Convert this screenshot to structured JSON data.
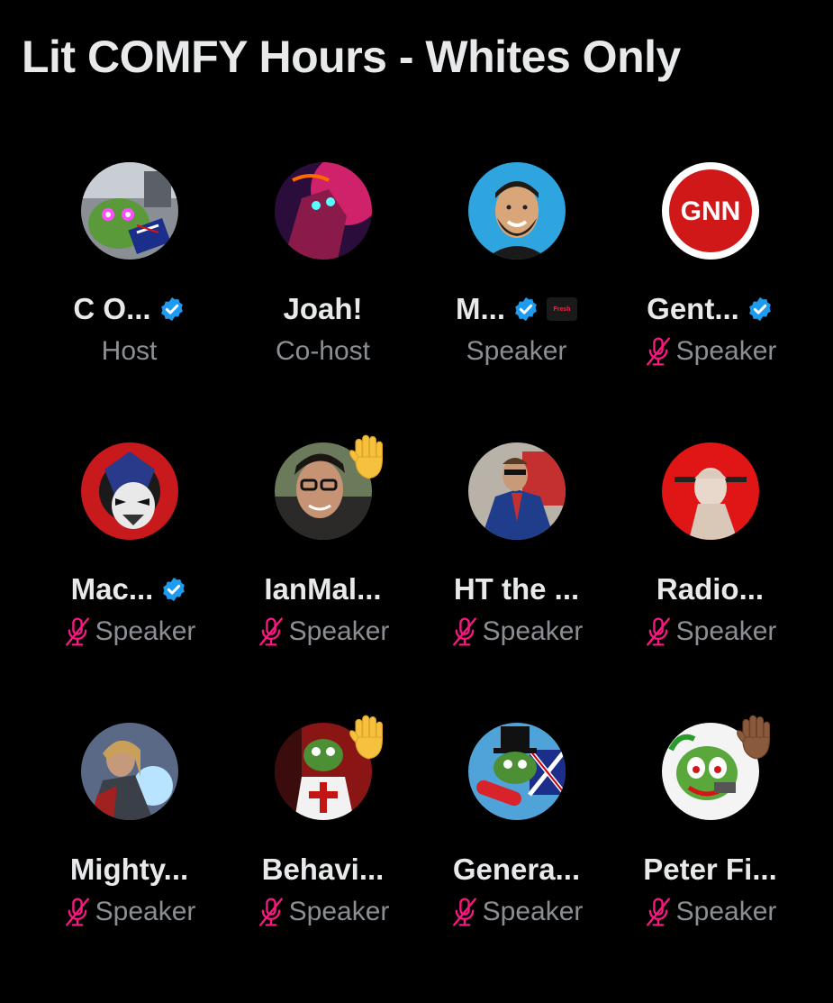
{
  "space": {
    "title": "Lit COMFY Hours - Whites Only"
  },
  "colors": {
    "background": "#000000",
    "name_text": "#e7e9ea",
    "role_text": "#8b8f94",
    "verified_blue": "#1d9bf0",
    "muted_mic": "#f91880"
  },
  "participants": [
    {
      "name": "C O...",
      "role": "Host",
      "verified": true,
      "muted": false,
      "hand_raised": false,
      "avatar_icon": "pepe-flag-avatar"
    },
    {
      "name": "Joah!",
      "role": "Co-host",
      "verified": false,
      "muted": false,
      "hand_raised": false,
      "avatar_icon": "neon-eyes-avatar"
    },
    {
      "name": "M...",
      "role": "Speaker",
      "verified": true,
      "muted": false,
      "hand_raised": false,
      "avatar_icon": "cartoon-man-avatar",
      "affiliate_badge": "Fresh"
    },
    {
      "name": "Gent...",
      "role": "Speaker",
      "verified": true,
      "muted": true,
      "hand_raised": false,
      "avatar_icon": "gnn-logo-avatar",
      "avatar_text": "GNN"
    },
    {
      "name": "Mac...",
      "role": "Speaker",
      "verified": true,
      "muted": true,
      "hand_raised": false,
      "avatar_icon": "mask-avatar"
    },
    {
      "name": "IanMal...",
      "role": "Speaker",
      "verified": false,
      "muted": true,
      "hand_raised": true,
      "avatar_icon": "man-glasses-avatar"
    },
    {
      "name": "HT the ...",
      "role": "Speaker",
      "verified": false,
      "muted": true,
      "hand_raised": false,
      "avatar_icon": "suited-man-avatar"
    },
    {
      "name": "Radio...",
      "role": "Speaker",
      "verified": false,
      "muted": true,
      "hand_raised": false,
      "avatar_icon": "statue-red-avatar"
    },
    {
      "name": "Mighty...",
      "role": "Speaker",
      "verified": false,
      "muted": true,
      "hand_raised": false,
      "avatar_icon": "thor-avatar"
    },
    {
      "name": "Behavi...",
      "role": "Speaker",
      "verified": false,
      "muted": true,
      "hand_raised": true,
      "avatar_icon": "pepe-crusader-avatar"
    },
    {
      "name": "Genera...",
      "role": "Speaker",
      "verified": false,
      "muted": true,
      "hand_raised": false,
      "avatar_icon": "pepe-tophat-avatar"
    },
    {
      "name": "Peter Fi...",
      "role": "Speaker",
      "verified": false,
      "muted": true,
      "hand_raised": true,
      "hand_tone": "dark",
      "avatar_icon": "pepe-clown-avatar"
    }
  ]
}
